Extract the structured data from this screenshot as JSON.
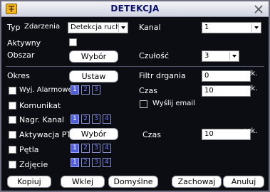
{
  "window": {
    "title": "DETEKCJA"
  },
  "left": {
    "typ_label": "Typ",
    "zdarzenia_label": "Zdarzenia",
    "typ_value": "Detekcja ruchu",
    "aktywny_label": "Aktywny",
    "obszar_label": "Obszar",
    "obszar_button": "Wybór",
    "okres_label": "Okres",
    "okres_button": "Ustaw",
    "wyj_alarmowe_label": "Wyj. Alarmowe",
    "wyj_alarmowe_nums": [
      "1",
      "2",
      "3"
    ],
    "komunikat_label": "Komunikat",
    "nagr_kanal_label": "Nagr. Kanal",
    "nagr_kanal_nums": [
      "1",
      "2",
      "3",
      "4"
    ],
    "aktywacja_ptz_label": "Aktywacja PTZ",
    "aktywacja_ptz_button": "Wybór",
    "petla_label": "Pętla",
    "petla_nums": [
      "1",
      "2",
      "3",
      "4"
    ],
    "zdjecie_label": "Zdjęcie",
    "zdjecie_nums": [
      "1",
      "2",
      "3",
      "4"
    ]
  },
  "right": {
    "kanal_label": "Kanal",
    "kanal_value": "1",
    "czulosc_label": "Czułość",
    "czulosc_value": "3",
    "filtr_label": "Filtr drgania",
    "filtr_value": "0",
    "filtr_unit": "sek.",
    "czas1_label": "Czas",
    "czas1_value": "10",
    "czas1_unit": "sek.",
    "email_label": "Wyślij email",
    "czas2_label": "Czas",
    "czas2_value": "10",
    "czas2_unit": "sek."
  },
  "footer": {
    "kopiuj": "Kopiuj",
    "wklej": "Wklej",
    "domyslne": "Domyślne",
    "zachowaj": "Zachowaj",
    "anuluj": "Anuluj"
  },
  "colors": {
    "background": "#0b0d13",
    "accent_blue": "#5260d8",
    "title_text": "#0a0f6b"
  }
}
